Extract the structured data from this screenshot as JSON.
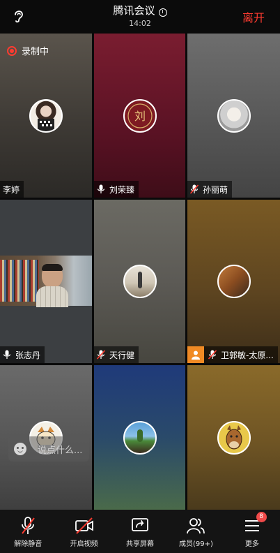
{
  "header": {
    "title": "腾讯会议",
    "time": "14:02",
    "leave_label": "离开"
  },
  "recording": {
    "label": "录制中"
  },
  "participants": [
    {
      "name": "李婷",
      "mic": "none"
    },
    {
      "name": "刘荣臻",
      "mic": "on"
    },
    {
      "name": "孙丽萌",
      "mic": "muted"
    },
    {
      "name": "张志丹",
      "mic": "on"
    },
    {
      "name": "天行健",
      "mic": "muted"
    },
    {
      "name": "卫郭敏-太原...",
      "mic": "muted"
    },
    {
      "name": "",
      "mic": "none"
    },
    {
      "name": "",
      "mic": "none"
    },
    {
      "name": "",
      "mic": "none"
    }
  ],
  "chat": {
    "placeholder": "说点什么..."
  },
  "toolbar": {
    "items": [
      {
        "label": "解除静音",
        "icon": "mic-muted-icon"
      },
      {
        "label": "开启视频",
        "icon": "video-off-icon"
      },
      {
        "label": "共享屏幕",
        "icon": "share-screen-icon"
      },
      {
        "label": "成员(99+)",
        "icon": "members-icon"
      },
      {
        "label": "更多",
        "icon": "more-menu-icon"
      }
    ],
    "more_badge": "8"
  },
  "colors": {
    "accent_red": "#ff3b30",
    "badge_red": "#f04a4a",
    "toolbar_bg": "#141414"
  }
}
